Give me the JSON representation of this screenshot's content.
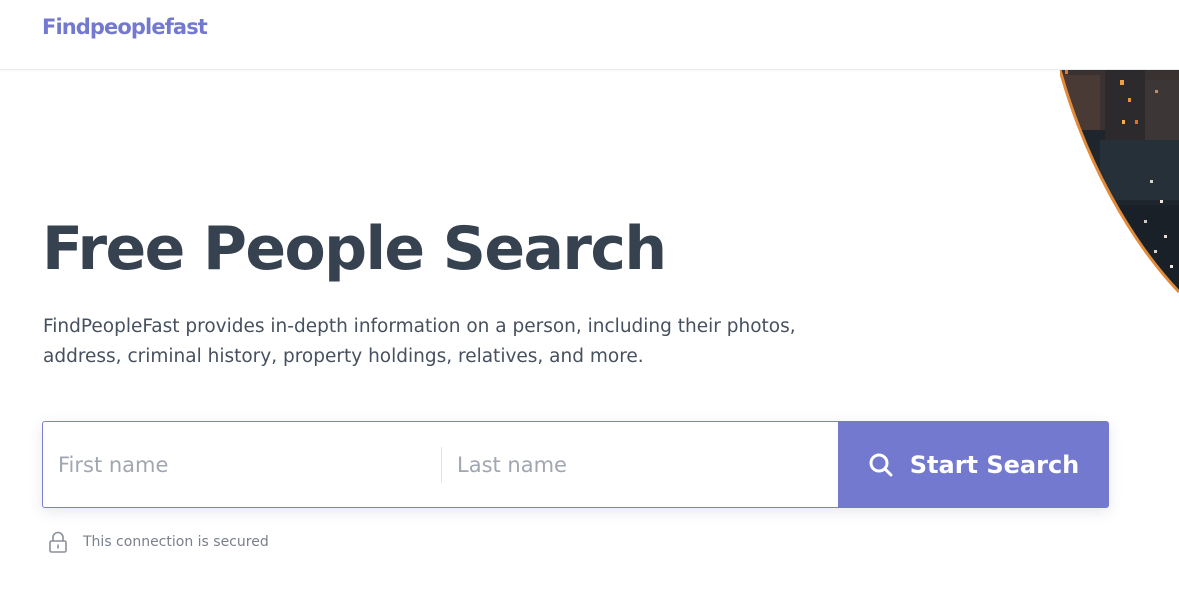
{
  "header": {
    "logo": "Findpeoplefast"
  },
  "hero": {
    "title": "Free People Search",
    "description_line1": "FindPeopleFast provides in-depth information on a person, including their photos,",
    "description_line2": "address, criminal history, property holdings, relatives, and more."
  },
  "search": {
    "first_name_placeholder": "First name",
    "last_name_placeholder": "Last name",
    "button_label": "Start Search",
    "button_icon": "search-icon"
  },
  "security": {
    "icon": "lock-icon",
    "text": "This connection is secured"
  },
  "colors": {
    "brand": "#7479d0",
    "title": "#36424f",
    "body_text": "#47505e",
    "muted": "#7a808c"
  }
}
